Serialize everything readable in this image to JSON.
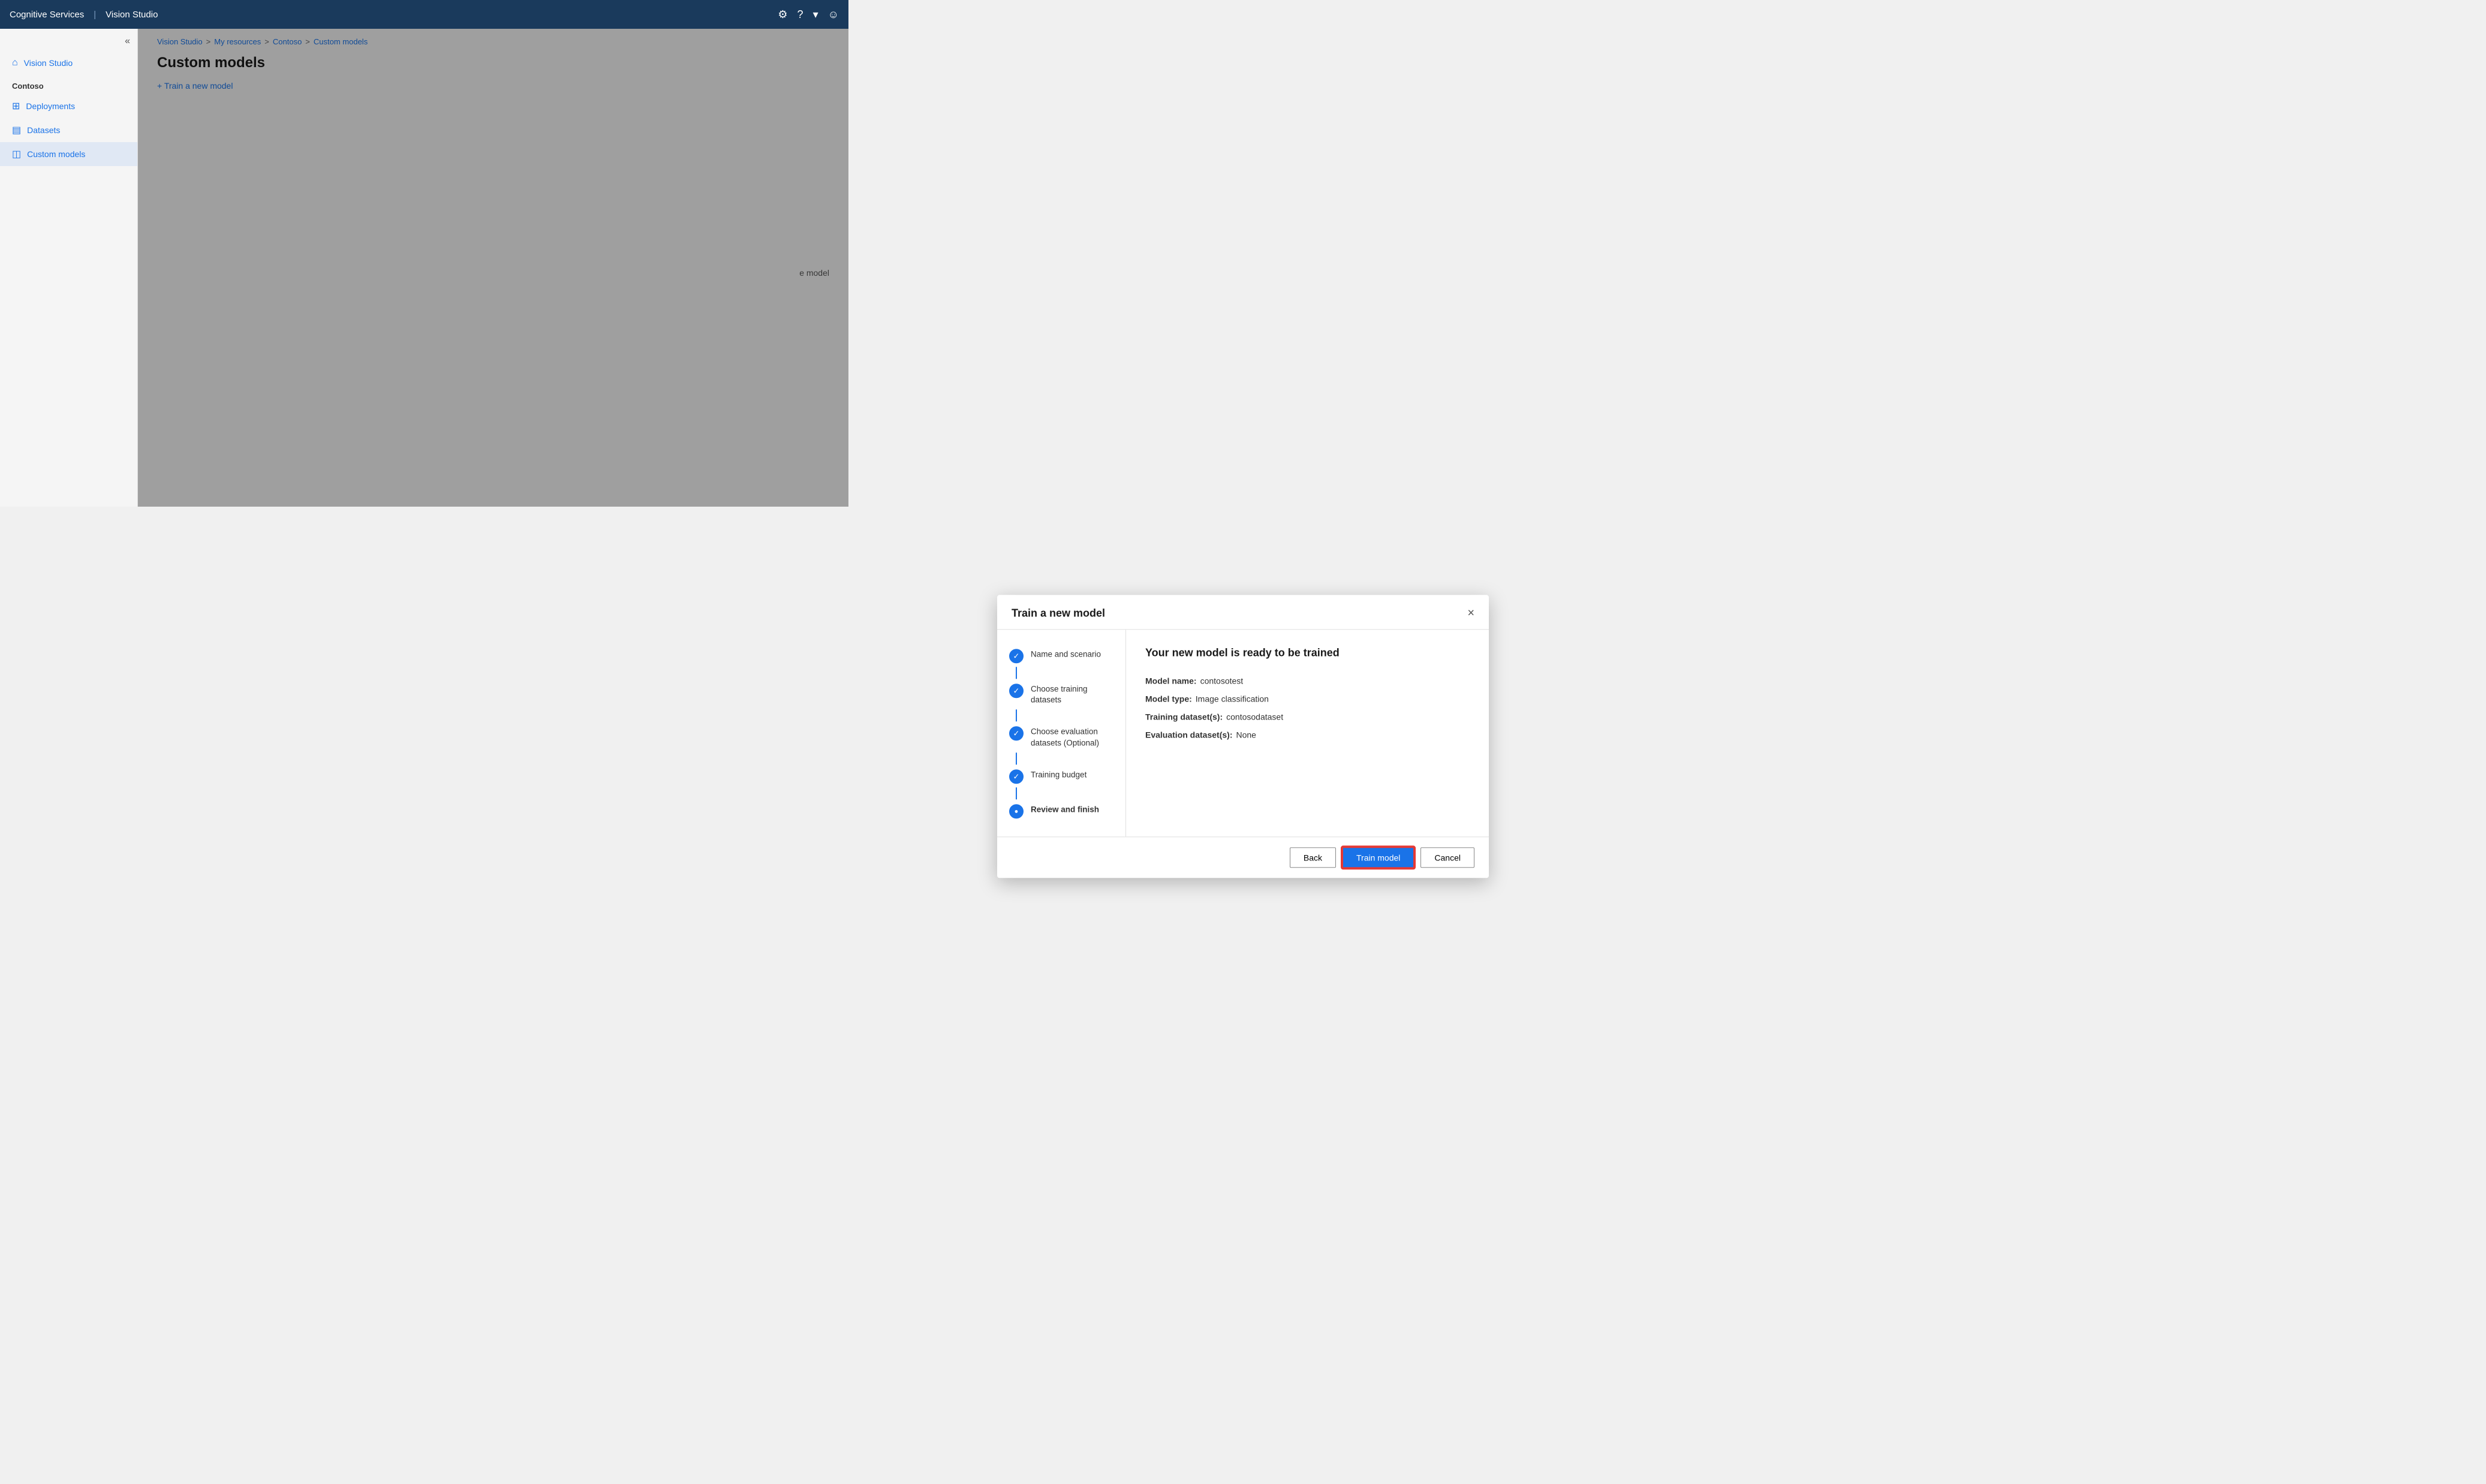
{
  "app": {
    "brand": "Cognitive Services",
    "divider": "|",
    "product": "Vision Studio"
  },
  "topbar": {
    "settings_icon": "⚙",
    "help_icon": "?",
    "chevron_icon": "▾",
    "user_icon": "☺"
  },
  "sidebar": {
    "collapse_icon": "«",
    "nav_items": [
      {
        "id": "vision-studio",
        "label": "Vision Studio",
        "icon": "⌂"
      },
      {
        "id": "section-contoso",
        "label": "Contoso",
        "type": "section"
      },
      {
        "id": "deployments",
        "label": "Deployments",
        "icon": "⊞"
      },
      {
        "id": "datasets",
        "label": "Datasets",
        "icon": "▤"
      },
      {
        "id": "custom-models",
        "label": "Custom models",
        "icon": "◫",
        "active": true
      }
    ]
  },
  "breadcrumb": {
    "items": [
      {
        "label": "Vision Studio",
        "link": true
      },
      {
        "label": ">"
      },
      {
        "label": "My resources",
        "link": true
      },
      {
        "label": ">"
      },
      {
        "label": "Contoso",
        "link": true
      },
      {
        "label": ">"
      },
      {
        "label": "Custom models",
        "link": true
      }
    ]
  },
  "page": {
    "title": "Custom models",
    "add_button": "+ Train a new model"
  },
  "modal": {
    "title": "Train a new model",
    "close_icon": "×",
    "wizard_steps": [
      {
        "id": "name-scenario",
        "label": "Name and scenario",
        "state": "completed"
      },
      {
        "id": "training-datasets",
        "label": "Choose training datasets",
        "state": "completed"
      },
      {
        "id": "evaluation-datasets",
        "label": "Choose evaluation datasets (Optional)",
        "state": "completed"
      },
      {
        "id": "training-budget",
        "label": "Training budget",
        "state": "completed"
      },
      {
        "id": "review-finish",
        "label": "Review and finish",
        "state": "current"
      }
    ],
    "content": {
      "title": "Your new model is ready to be trained",
      "details": [
        {
          "label": "Model name:",
          "value": "contosotest"
        },
        {
          "label": "Model type:",
          "value": "Image classification"
        },
        {
          "label": "Training dataset(s):",
          "value": "contosodataset"
        },
        {
          "label": "Evaluation dataset(s):",
          "value": "None"
        }
      ]
    },
    "footer": {
      "back_label": "Back",
      "train_label": "Train model",
      "cancel_label": "Cancel"
    }
  },
  "background": {
    "right_hint": "e model"
  }
}
